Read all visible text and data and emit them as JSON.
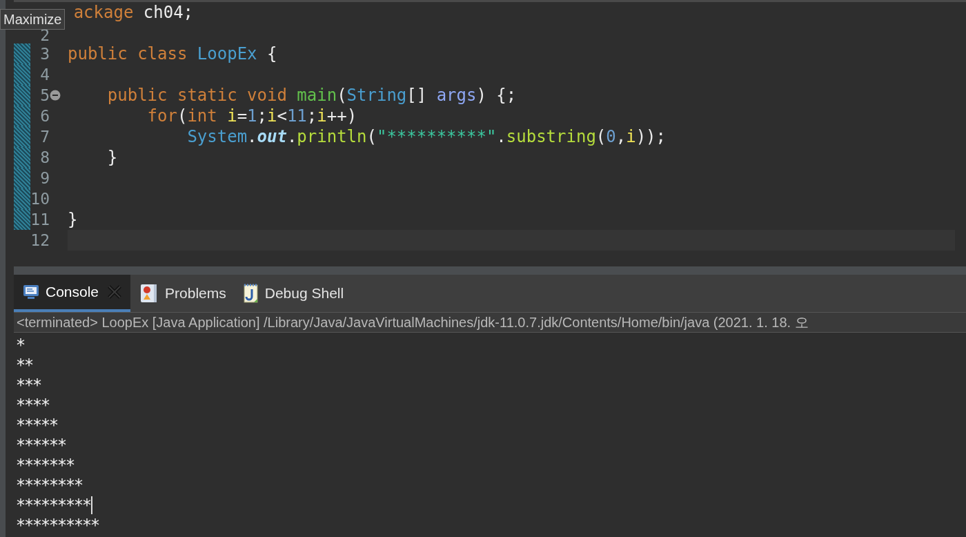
{
  "tooltip": {
    "text": "Maximize"
  },
  "editor": {
    "lines": [
      {
        "clipped_left": true,
        "tokens": [
          {
            "kind": "keyword",
            "text": "ackage"
          },
          {
            "kind": "plain",
            "text": " ch04;"
          }
        ]
      },
      {
        "number": "2"
      },
      {
        "number": "3",
        "changed": true,
        "tokens": [
          {
            "kind": "keyword",
            "text": "public class "
          },
          {
            "kind": "type",
            "text": "LoopEx"
          },
          {
            "kind": "plain",
            "text": " {"
          }
        ]
      },
      {
        "number": "4",
        "changed": true
      },
      {
        "number": "5",
        "changed": true,
        "foldable": true,
        "tokens": [
          {
            "kind": "keyword",
            "text": "    public static void "
          },
          {
            "kind": "method",
            "text": "main"
          },
          {
            "kind": "plain",
            "text": "("
          },
          {
            "kind": "type",
            "text": "String"
          },
          {
            "kind": "plain",
            "text": "[] "
          },
          {
            "kind": "param",
            "text": "args"
          },
          {
            "kind": "plain",
            "text": ") {;"
          }
        ]
      },
      {
        "number": "6",
        "changed": true,
        "tokens": [
          {
            "kind": "keyword",
            "text": "        for"
          },
          {
            "kind": "plain",
            "text": "("
          },
          {
            "kind": "keyword",
            "text": "int "
          },
          {
            "kind": "local",
            "text": "i"
          },
          {
            "kind": "plain",
            "text": "="
          },
          {
            "kind": "number",
            "text": "1"
          },
          {
            "kind": "plain",
            "text": ";"
          },
          {
            "kind": "local",
            "text": "i"
          },
          {
            "kind": "plain",
            "text": "<"
          },
          {
            "kind": "number",
            "text": "11"
          },
          {
            "kind": "plain",
            "text": ";"
          },
          {
            "kind": "local",
            "text": "i"
          },
          {
            "kind": "plain",
            "text": "++)"
          }
        ]
      },
      {
        "number": "7",
        "changed": true,
        "tokens": [
          {
            "kind": "type",
            "text": "            System"
          },
          {
            "kind": "plain",
            "text": "."
          },
          {
            "kind": "field",
            "text": "out"
          },
          {
            "kind": "plain",
            "text": "."
          },
          {
            "kind": "call",
            "text": "println"
          },
          {
            "kind": "plain",
            "text": "("
          },
          {
            "kind": "string",
            "text": "\"**********\""
          },
          {
            "kind": "plain",
            "text": "."
          },
          {
            "kind": "call",
            "text": "substring"
          },
          {
            "kind": "plain",
            "text": "("
          },
          {
            "kind": "number",
            "text": "0"
          },
          {
            "kind": "plain",
            "text": ","
          },
          {
            "kind": "local",
            "text": "i"
          },
          {
            "kind": "plain",
            "text": "));"
          }
        ]
      },
      {
        "number": "8",
        "changed": true,
        "tokens": [
          {
            "kind": "plain",
            "text": "    }"
          }
        ]
      },
      {
        "number": "9",
        "changed": true
      },
      {
        "number": "10",
        "changed": true
      },
      {
        "number": "11",
        "changed": true,
        "tokens": [
          {
            "kind": "plain",
            "text": "}"
          }
        ]
      },
      {
        "number": "12",
        "current": true
      }
    ]
  },
  "console": {
    "tabs": [
      {
        "label": "Console",
        "selected": true,
        "closable": true
      },
      {
        "label": "Problems",
        "selected": false,
        "closable": false
      },
      {
        "label": "Debug Shell",
        "selected": false,
        "closable": false
      }
    ],
    "status": "<terminated> LoopEx [Java Application] /Library/Java/JavaVirtualMachines/jdk-11.0.7.jdk/Contents/Home/bin/java  (2021. 1. 18. 오",
    "output": [
      {
        "text": "*",
        "caret": false
      },
      {
        "text": "**",
        "caret": false
      },
      {
        "text": "***",
        "caret": false
      },
      {
        "text": "****",
        "caret": false
      },
      {
        "text": "*****",
        "caret": false
      },
      {
        "text": "******",
        "caret": false
      },
      {
        "text": "*******",
        "caret": false
      },
      {
        "text": "********",
        "caret": false
      },
      {
        "text": "*********",
        "caret": true
      },
      {
        "text": "**********",
        "caret": false
      }
    ]
  }
}
